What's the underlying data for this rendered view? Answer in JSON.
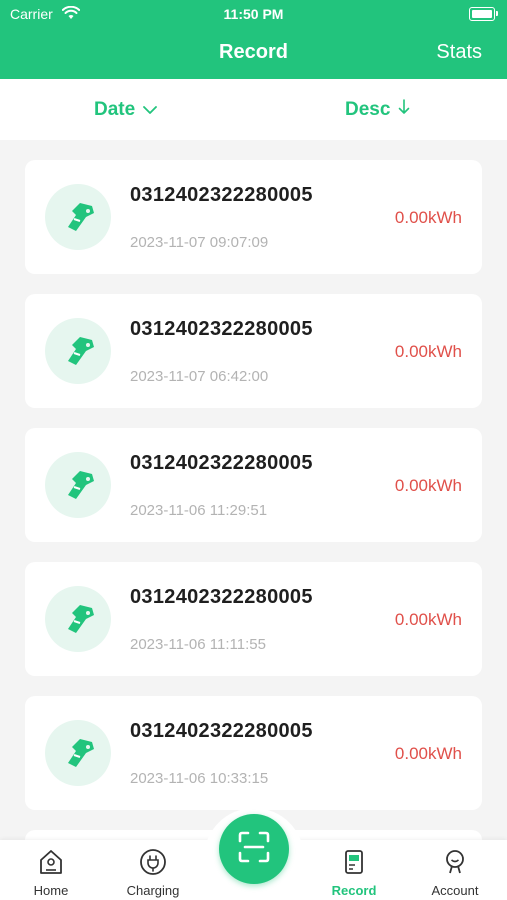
{
  "status_bar": {
    "carrier": "Carrier",
    "time": "11:50 PM"
  },
  "header": {
    "title": "Record",
    "stats_label": "Stats"
  },
  "filters": {
    "date_label": "Date",
    "order_label": "Desc"
  },
  "records": [
    {
      "code": "0312402322280005",
      "timestamp": "2023-11-07 09:07:09",
      "energy": "0.00kWh"
    },
    {
      "code": "0312402322280005",
      "timestamp": "2023-11-07 06:42:00",
      "energy": "0.00kWh"
    },
    {
      "code": "0312402322280005",
      "timestamp": "2023-11-06 11:29:51",
      "energy": "0.00kWh"
    },
    {
      "code": "0312402322280005",
      "timestamp": "2023-11-06 11:11:55",
      "energy": "0.00kWh"
    },
    {
      "code": "0312402322280005",
      "timestamp": "2023-11-06 10:33:15",
      "energy": "0.00kWh"
    }
  ],
  "tabbar": {
    "home": "Home",
    "charging": "Charging",
    "record": "Record",
    "account": "Account"
  },
  "colors": {
    "brand": "#22c47d",
    "energy": "#e0504a",
    "timestamp": "#b3b3b3"
  },
  "icons": [
    "wifi-icon",
    "battery-icon",
    "chevron-down-icon",
    "arrow-down-icon",
    "charging-gun-icon",
    "home-icon",
    "plug-icon",
    "scan-icon",
    "record-icon",
    "account-icon"
  ]
}
